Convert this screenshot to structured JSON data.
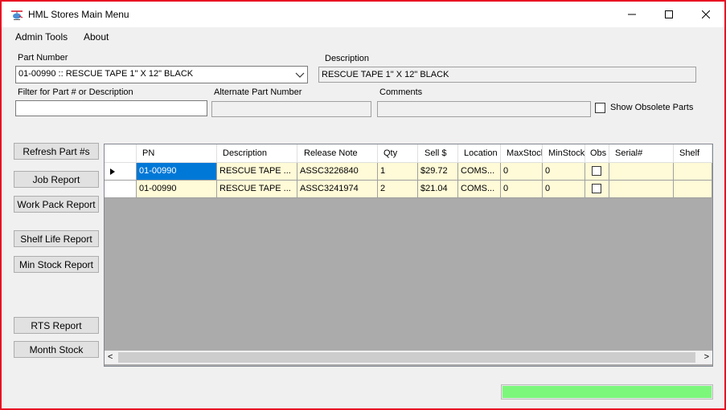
{
  "window": {
    "title": "HML Stores Main Menu"
  },
  "menu": {
    "items": [
      "Admin Tools",
      "About"
    ]
  },
  "form": {
    "part_number_label": "Part Number",
    "part_number_value": "01-00990 :: RESCUE TAPE 1\" X 12\" BLACK",
    "description_label": "Description",
    "description_value": "RESCUE TAPE 1\" X 12\" BLACK",
    "filter_label": "Filter for Part # or Description",
    "filter_value": "",
    "alt_part_label": "Alternate Part Number",
    "alt_part_value": "",
    "comments_label": "Comments",
    "comments_value": "",
    "show_obsolete_label": "Show Obsolete Parts",
    "show_obsolete_checked": false
  },
  "buttons": {
    "refresh": "Refresh Part #s",
    "job_report": "Job Report",
    "work_pack_report": "Work Pack Report",
    "shelf_life_report": "Shelf Life Report",
    "min_stock_report": "Min Stock Report",
    "rts_report": "RTS Report",
    "month_stock": "Month Stock"
  },
  "grid": {
    "columns": [
      "PN",
      "Description",
      "Release Note",
      "Qty",
      "Sell $",
      "Location",
      "MaxStock",
      "MinStock",
      "Obs",
      "Serial#",
      "Shelf"
    ],
    "rows": [
      {
        "current": true,
        "cells": [
          "01-00990",
          "RESCUE TAPE ...",
          "ASSC3226840",
          "1",
          "$29.72",
          "COMS...",
          "0",
          "0",
          "",
          "",
          ""
        ],
        "obs": false
      },
      {
        "current": false,
        "cells": [
          "01-00990",
          "RESCUE TAPE ...",
          "ASSC3241974",
          "2",
          "$21.04",
          "COMS...",
          "0",
          "0",
          "",
          "",
          ""
        ],
        "obs": false
      }
    ]
  },
  "progress": {
    "value": 1.0,
    "color": "#7cf77c"
  },
  "colors": {
    "accent_border": "#e81123",
    "selection": "#0078d7",
    "row_fill": "#fffad7"
  },
  "icons": {
    "app": "helicopter-icon",
    "row_indicator": "current-row-arrow-icon"
  }
}
